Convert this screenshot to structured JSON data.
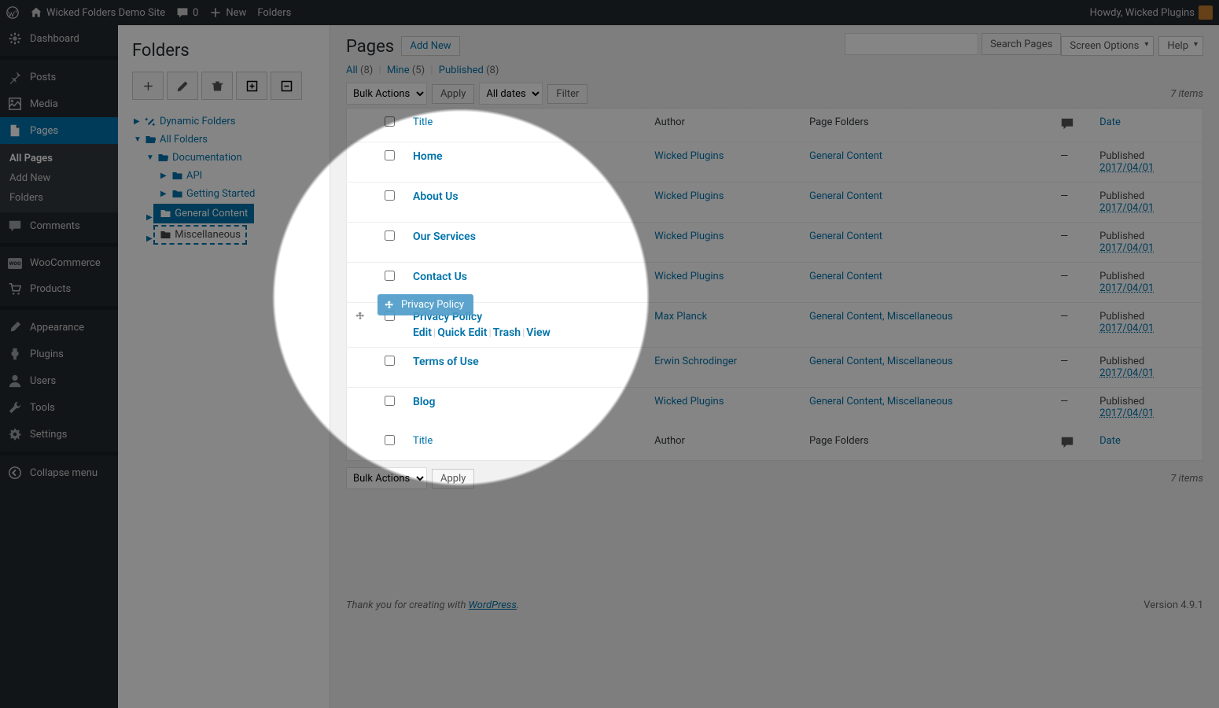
{
  "adminbar": {
    "site": "Wicked Folders Demo Site",
    "comments": "0",
    "new": "New",
    "folders": "Folders",
    "howdy": "Howdy, Wicked Plugins"
  },
  "menu": {
    "dashboard": "Dashboard",
    "posts": "Posts",
    "media": "Media",
    "pages": "Pages",
    "pages_sub": {
      "all": "All Pages",
      "add": "Add New",
      "folders": "Folders"
    },
    "comments": "Comments",
    "woo": "WooCommerce",
    "products": "Products",
    "appearance": "Appearance",
    "plugins": "Plugins",
    "users": "Users",
    "tools": "Tools",
    "settings": "Settings",
    "collapse": "Collapse menu"
  },
  "folderpane": {
    "title": "Folders",
    "tree": {
      "dynamic": "Dynamic Folders",
      "all": "All Folders",
      "documentation": "Documentation",
      "api": "API",
      "getting_started": "Getting Started",
      "general_content": "General Content",
      "miscellaneous": "Miscellaneous"
    }
  },
  "content": {
    "screen_options": "Screen Options",
    "help": "Help",
    "heading": "Pages",
    "addnew": "Add New",
    "subsub": {
      "all_label": "All",
      "all_count": "(8)",
      "mine_label": "Mine",
      "mine_count": "(5)",
      "published_label": "Published",
      "published_count": "(8)"
    },
    "search_btn": "Search Pages",
    "bulk": "Bulk Actions",
    "apply": "Apply",
    "all_dates": "All dates",
    "filter": "Filter",
    "items": "7 items",
    "cols": {
      "title": "Title",
      "author": "Author",
      "folders": "Page Folders",
      "date": "Date"
    },
    "rowactions": {
      "edit": "Edit",
      "quick": "Quick Edit",
      "trash": "Trash",
      "view": "View"
    },
    "dash": "—",
    "rows": [
      {
        "title": "Home",
        "author": "Wicked Plugins",
        "folders": "General Content",
        "status": "Published",
        "date": "2017/04/01",
        "actions": false,
        "drag": false
      },
      {
        "title": "About Us",
        "author": "Wicked Plugins",
        "folders": "General Content",
        "status": "Published",
        "date": "2017/04/01",
        "actions": false,
        "drag": false
      },
      {
        "title": "Our Services",
        "author": "Wicked Plugins",
        "folders": "General Content",
        "status": "Published",
        "date": "2017/04/01",
        "actions": false,
        "drag": false
      },
      {
        "title": "Contact Us",
        "author": "Wicked Plugins",
        "folders": "General Content",
        "status": "Published",
        "date": "2017/04/01",
        "actions": false,
        "drag": false
      },
      {
        "title": "Privacy Policy",
        "author": "Max Planck",
        "folders": "General Content, Miscellaneous",
        "status": "Published",
        "date": "2017/04/01",
        "actions": true,
        "drag": true
      },
      {
        "title": "Terms of Use",
        "author": "Erwin Schrodinger",
        "folders": "General Content, Miscellaneous",
        "status": "Published",
        "date": "2017/04/01",
        "actions": false,
        "drag": false
      },
      {
        "title": "Blog",
        "author": "Wicked Plugins",
        "folders": "General Content, Miscellaneous",
        "status": "Published",
        "date": "2017/04/01",
        "actions": false,
        "drag": false
      }
    ]
  },
  "drag": {
    "label": "Privacy Policy"
  },
  "footer": {
    "thank_pre": "Thank you for creating with ",
    "wp": "WordPress",
    "period": ".",
    "version": "Version 4.9.1"
  }
}
